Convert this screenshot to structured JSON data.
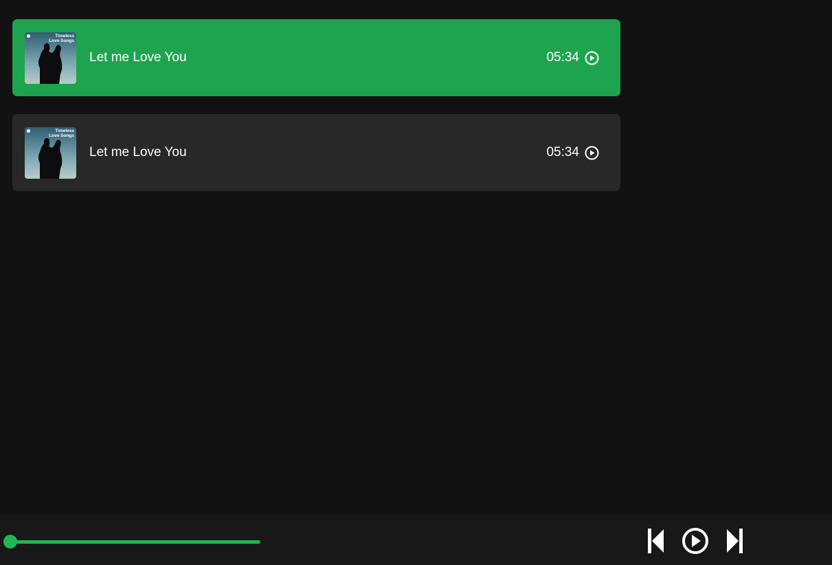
{
  "colors": {
    "background": "#121212",
    "active_card": "#1ea44f",
    "inactive_card": "#282828",
    "player_bar": "#181818",
    "accent": "#1db954",
    "text": "#ffffff"
  },
  "songs": [
    {
      "title": "Let me Love You",
      "duration": "05:34",
      "cover_line1": "Timeless",
      "cover_line2": "Love Songs",
      "state": "active",
      "icon": "play-circle-icon"
    },
    {
      "title": "Let me Love You",
      "duration": "05:34",
      "cover_line1": "Timeless",
      "cover_line2": "Love Songs",
      "state": "inactive",
      "icon": "play-circle-icon"
    }
  ],
  "player": {
    "progress_percent": 0,
    "controls": [
      "previous-icon",
      "play-circle-icon",
      "next-icon"
    ]
  }
}
